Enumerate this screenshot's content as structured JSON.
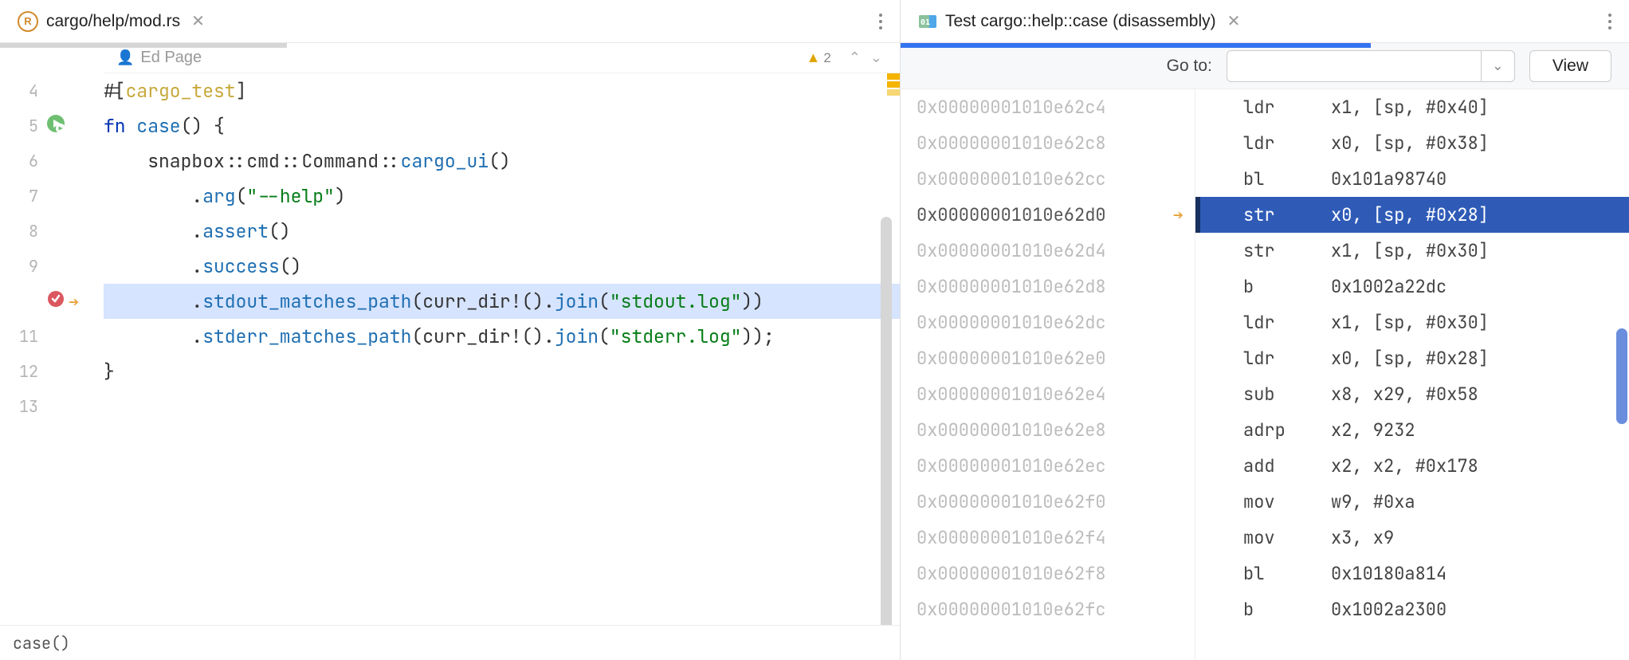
{
  "left": {
    "tab": {
      "label": "cargo/help/mod.rs",
      "icon": "rust-file"
    },
    "author": "Ed Page",
    "warnings_count": "2",
    "lines": [
      {
        "n": "4",
        "gutter": null,
        "tokens": [
          [
            "#[",
            "punc"
          ],
          [
            "cargo_test",
            "attr"
          ],
          [
            "]",
            "punc"
          ]
        ]
      },
      {
        "n": "5",
        "gutter": "run",
        "tokens": [
          [
            "fn ",
            "kw"
          ],
          [
            "case",
            "fn"
          ],
          [
            "() {",
            "punc"
          ]
        ]
      },
      {
        "n": "6",
        "gutter": null,
        "tokens": [
          [
            "    snapbox",
            "id"
          ],
          [
            "::",
            "punc"
          ],
          [
            "cmd",
            "id"
          ],
          [
            "::",
            "punc"
          ],
          [
            "Command",
            "id"
          ],
          [
            "::",
            "punc"
          ],
          [
            "cargo_ui",
            "fn"
          ],
          [
            "()",
            "punc"
          ]
        ]
      },
      {
        "n": "7",
        "gutter": null,
        "tokens": [
          [
            "        .",
            "punc"
          ],
          [
            "arg",
            "fn"
          ],
          [
            "(",
            "punc"
          ],
          [
            "\"--help\"",
            "str"
          ],
          [
            ")",
            "punc"
          ]
        ]
      },
      {
        "n": "8",
        "gutter": null,
        "tokens": [
          [
            "        .",
            "punc"
          ],
          [
            "assert",
            "fn"
          ],
          [
            "()",
            "punc"
          ]
        ]
      },
      {
        "n": "9",
        "gutter": null,
        "tokens": [
          [
            "        .",
            "punc"
          ],
          [
            "success",
            "fn"
          ],
          [
            "()",
            "punc"
          ]
        ]
      },
      {
        "n": "",
        "gutter": "bp-current",
        "highlight": true,
        "tokens": [
          [
            "        .",
            "punc"
          ],
          [
            "stdout_matches_path",
            "fn"
          ],
          [
            "(",
            "punc"
          ],
          [
            "curr_dir!",
            "macro"
          ],
          [
            "().",
            "punc"
          ],
          [
            "join",
            "fn"
          ],
          [
            "(",
            "punc"
          ],
          [
            "\"stdout.log\"",
            "str"
          ],
          [
            "))",
            "punc"
          ]
        ]
      },
      {
        "n": "11",
        "gutter": null,
        "tokens": [
          [
            "        .",
            "punc"
          ],
          [
            "stderr_matches_path",
            "fn"
          ],
          [
            "(",
            "punc"
          ],
          [
            "curr_dir!",
            "macro"
          ],
          [
            "().",
            "punc"
          ],
          [
            "join",
            "fn"
          ],
          [
            "(",
            "punc"
          ],
          [
            "\"stderr.log\"",
            "str"
          ],
          [
            "));",
            "punc"
          ]
        ]
      },
      {
        "n": "12",
        "gutter": null,
        "tokens": [
          [
            "}",
            "punc"
          ]
        ]
      },
      {
        "n": "13",
        "gutter": null,
        "tokens": []
      }
    ],
    "breadcrumb": "case()"
  },
  "right": {
    "tab": {
      "label": "Test cargo::help::case (disassembly)"
    },
    "goto_label": "Go to:",
    "goto_value": "",
    "view_button": "View",
    "rows": [
      {
        "addr": "0x00000001010e62c4",
        "mn": "ldr",
        "ops": "x1, [sp, #0x40]"
      },
      {
        "addr": "0x00000001010e62c8",
        "mn": "ldr",
        "ops": "x0, [sp, #0x38]"
      },
      {
        "addr": "0x00000001010e62cc",
        "mn": "bl",
        "ops": "0x101a98740"
      },
      {
        "addr": "0x00000001010e62d0",
        "mn": "str",
        "ops": "x0, [sp, #0x28]",
        "current": true
      },
      {
        "addr": "0x00000001010e62d4",
        "mn": "str",
        "ops": "x1, [sp, #0x30]"
      },
      {
        "addr": "0x00000001010e62d8",
        "mn": "b",
        "ops": "0x1002a22dc"
      },
      {
        "addr": "0x00000001010e62dc",
        "mn": "ldr",
        "ops": "x1, [sp, #0x30]"
      },
      {
        "addr": "0x00000001010e62e0",
        "mn": "ldr",
        "ops": "x0, [sp, #0x28]"
      },
      {
        "addr": "0x00000001010e62e4",
        "mn": "sub",
        "ops": "x8, x29, #0x58"
      },
      {
        "addr": "0x00000001010e62e8",
        "mn": "adrp",
        "ops": "x2, 9232"
      },
      {
        "addr": "0x00000001010e62ec",
        "mn": "add",
        "ops": "x2, x2, #0x178"
      },
      {
        "addr": "0x00000001010e62f0",
        "mn": "mov",
        "ops": "w9, #0xa"
      },
      {
        "addr": "0x00000001010e62f4",
        "mn": "mov",
        "ops": "x3, x9"
      },
      {
        "addr": "0x00000001010e62f8",
        "mn": "bl",
        "ops": "0x10180a814"
      },
      {
        "addr": "0x00000001010e62fc",
        "mn": "b",
        "ops": "0x1002a2300"
      }
    ]
  }
}
